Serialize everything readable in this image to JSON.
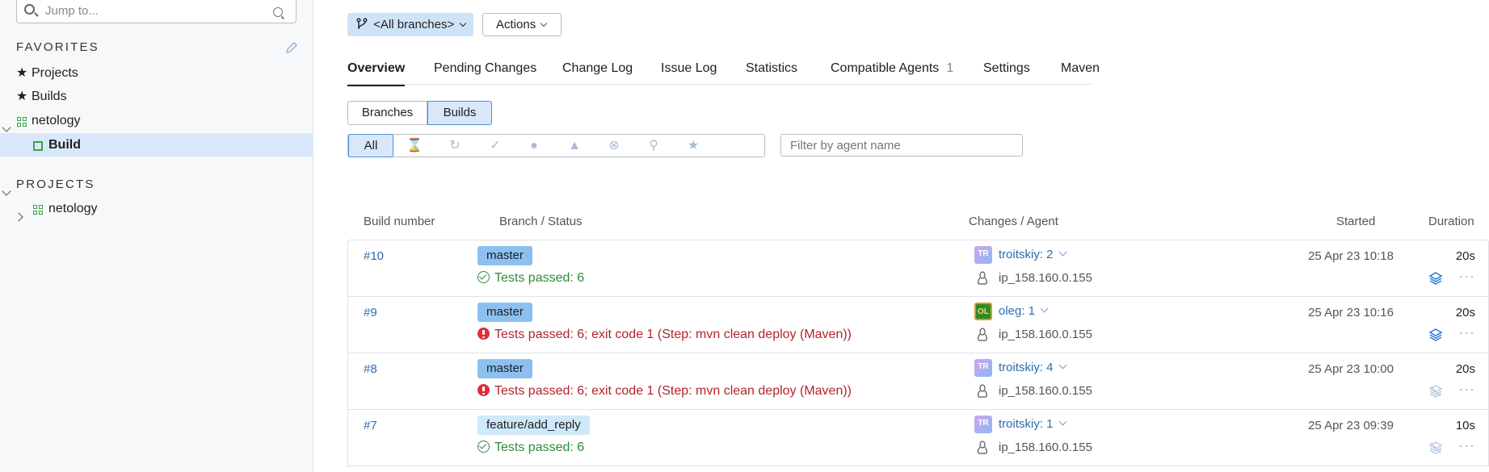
{
  "sidebar": {
    "search_placeholder": "Jump to...",
    "favorites_title": "FAVORITES",
    "projects_title": "PROJECTS",
    "favorites": [
      {
        "label": "Projects",
        "icon": "star-icon"
      },
      {
        "label": "Builds",
        "icon": "star-icon"
      }
    ],
    "tree": [
      {
        "label": "netology",
        "icon": "project-grid-icon",
        "expanded": true
      },
      {
        "label": "Build",
        "icon": "build-config-icon",
        "selected": true
      }
    ],
    "projects": [
      {
        "label": "netology",
        "icon": "project-grid-icon",
        "expanded": false
      }
    ]
  },
  "toolbar": {
    "branch_label": "<All branches>",
    "actions_label": "Actions"
  },
  "tabs": [
    {
      "label": "Overview",
      "active": true
    },
    {
      "label": "Pending Changes"
    },
    {
      "label": "Change Log"
    },
    {
      "label": "Issue Log"
    },
    {
      "label": "Statistics"
    },
    {
      "label": "Compatible Agents",
      "count": "1"
    },
    {
      "label": "Settings"
    },
    {
      "label": "Maven"
    }
  ],
  "view_toggle": {
    "branches": "Branches",
    "builds": "Builds",
    "selected": "builds"
  },
  "filters": {
    "all": "All",
    "icons": [
      "hourglass-icon",
      "running-icon",
      "success-icon",
      "failed-icon",
      "warning-icon",
      "cancelled-icon",
      "pin-icon",
      "star-icon"
    ],
    "agent_placeholder": "Filter by agent name"
  },
  "table": {
    "headers": {
      "build_number": "Build number",
      "branch_status": "Branch / Status",
      "changes_agent": "Changes / Agent",
      "started": "Started",
      "duration": "Duration"
    },
    "rows": [
      {
        "number": "#10",
        "branch": "master",
        "status": "Tests passed: 6",
        "result": "ok",
        "avatar": "TR",
        "changes": "troitskiy: 2",
        "agent": "ip_158.160.0.155",
        "started": "25 Apr 23 10:18",
        "duration": "20s",
        "artifacts": true
      },
      {
        "number": "#9",
        "branch": "master",
        "status": "Tests passed: 6; exit code 1 (Step: mvn clean deploy (Maven))",
        "result": "fail",
        "avatar": "OL",
        "changes": "oleg: 1",
        "agent": "ip_158.160.0.155",
        "started": "25 Apr 23 10:16",
        "duration": "20s",
        "artifacts": true
      },
      {
        "number": "#8",
        "branch": "master",
        "status": "Tests passed: 6; exit code 1 (Step: mvn clean deploy (Maven))",
        "result": "fail",
        "avatar": "TR",
        "changes": "troitskiy: 4",
        "agent": "ip_158.160.0.155",
        "started": "25 Apr 23 10:00",
        "duration": "20s",
        "artifacts": false
      },
      {
        "number": "#7",
        "branch": "feature/add_reply",
        "status": "Tests passed: 6",
        "result": "ok",
        "avatar": "TR",
        "changes": "troitskiy: 1",
        "agent": "ip_158.160.0.155",
        "started": "25 Apr 23 09:39",
        "duration": "10s",
        "artifacts": false
      }
    ]
  },
  "colors": {
    "link": "#2b6cb0",
    "success": "#2e8b3a",
    "failure": "#d9303a",
    "selected_bg": "#d8e8fa",
    "tag_default_branch": "#8cc0f0",
    "tag_feature_branch": "#cfe8fa"
  }
}
